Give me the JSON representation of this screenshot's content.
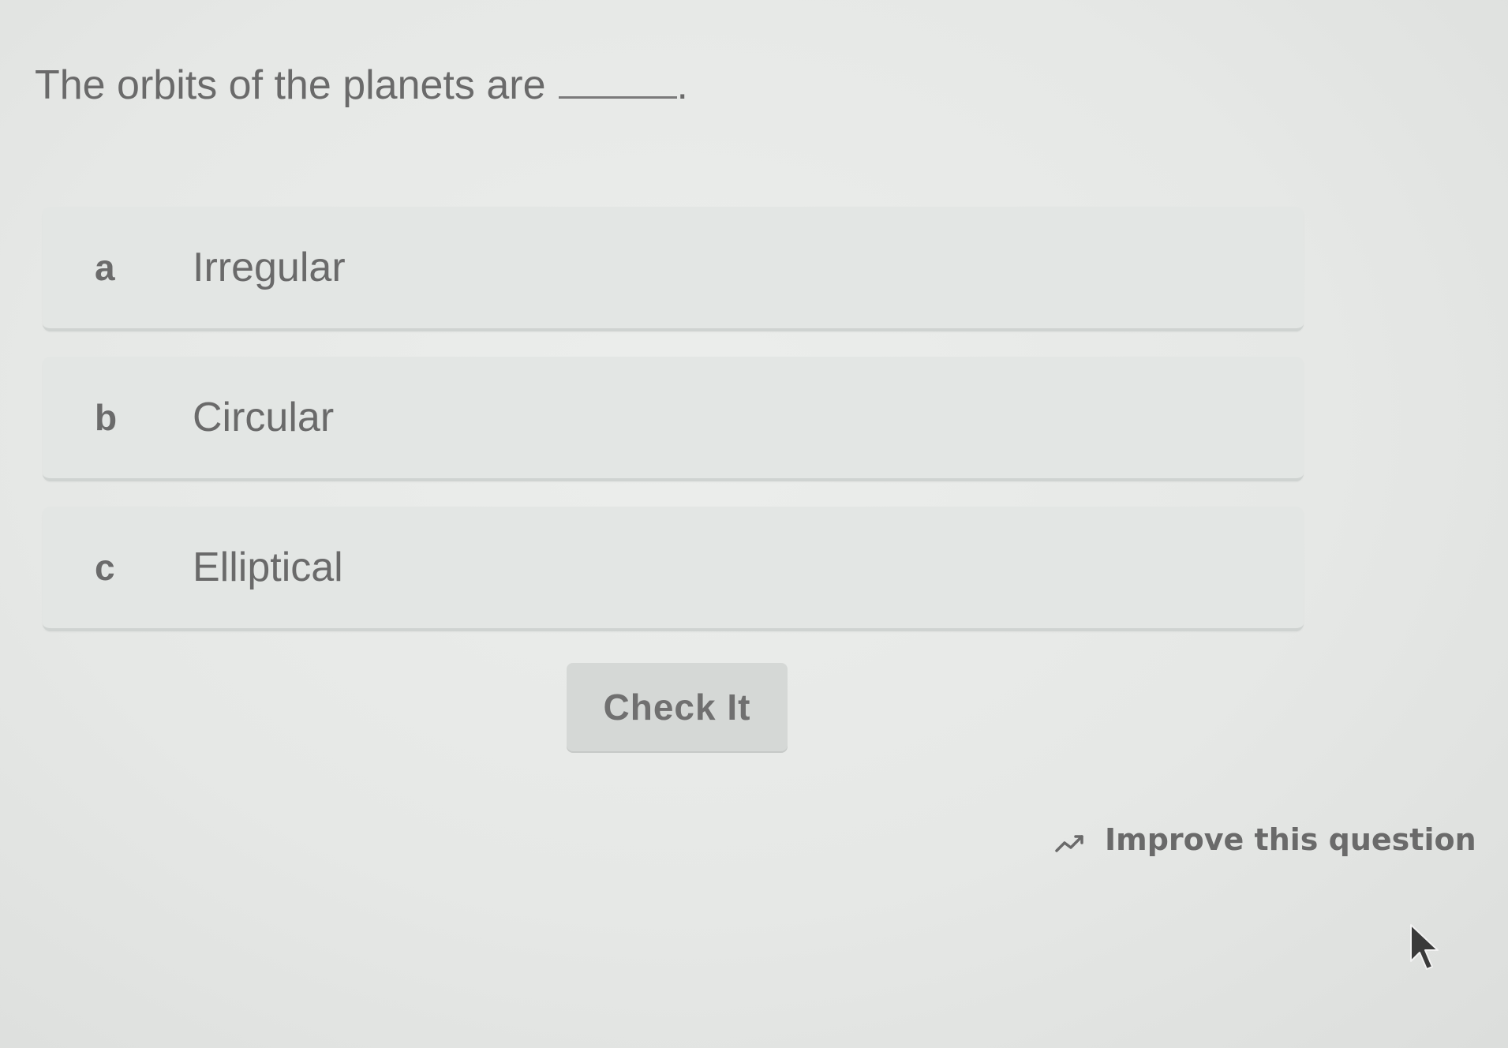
{
  "question": {
    "text": "The orbits of the planets are",
    "blank_suffix": "."
  },
  "options": [
    {
      "letter": "a",
      "label": "Irregular"
    },
    {
      "letter": "b",
      "label": "Circular"
    },
    {
      "letter": "c",
      "label": "Elliptical"
    }
  ],
  "actions": {
    "check_label": "Check It",
    "improve_label": "Improve this question",
    "improve_icon": "trending-line-icon"
  },
  "cursor": {
    "icon": "mouse-pointer-icon"
  }
}
